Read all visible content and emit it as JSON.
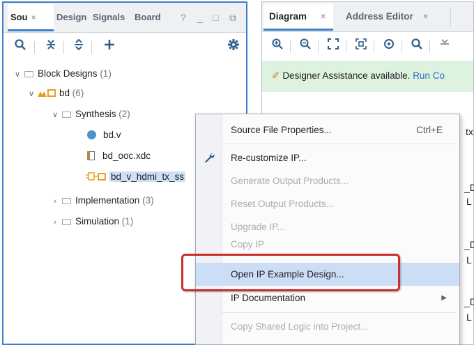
{
  "left_panel": {
    "tabs": [
      {
        "label": "Sou",
        "close": "×",
        "active": true
      },
      {
        "label": "Design",
        "active": false
      },
      {
        "label": "Signals",
        "active": false
      },
      {
        "label": "Board",
        "active": false
      }
    ],
    "window_controls": {
      "help": "?",
      "minimize": "_",
      "maximize": "□",
      "restore": "⧉"
    },
    "toolbar": {
      "search": "search-icon",
      "collapse": "collapse-all-icon",
      "expand": "expand-all-icon",
      "add": "add-icon",
      "settings": "gear-icon"
    },
    "tree": {
      "block_designs": {
        "label": "Block Designs",
        "count": "(1)"
      },
      "bd": {
        "label": "bd",
        "count": "(6)"
      },
      "synthesis": {
        "label": "Synthesis",
        "count": "(2)"
      },
      "bd_v": {
        "label": "bd.v"
      },
      "bd_ooc": {
        "label": "bd_ooc.xdc"
      },
      "bd_v_hdmi": {
        "label": "bd_v_hdmi_tx_ss"
      },
      "implementation": {
        "label": "Implementation",
        "count": "(3)"
      },
      "simulation": {
        "label": "Simulation",
        "count": "(1)"
      }
    }
  },
  "right_panel": {
    "tabs": [
      {
        "label": "Diagram",
        "close": "×",
        "active": true
      },
      {
        "label": "Address Editor",
        "close": "×",
        "active": false
      }
    ],
    "assist": {
      "text": "Designer Assistance available.",
      "link": "Run Co"
    },
    "diagram_fragments": [
      "tx",
      "_D",
      "L",
      "_D",
      "L",
      "_D",
      "L"
    ]
  },
  "context_menu": {
    "items": [
      {
        "label": "Source File Properties...",
        "shortcut": "Ctrl+E",
        "enabled": true
      },
      {
        "label": "Re-customize IP...",
        "enabled": true
      },
      {
        "label": "Generate Output Products...",
        "enabled": false
      },
      {
        "label": "Reset Output Products...",
        "enabled": false
      },
      {
        "label": "Upgrade IP...",
        "enabled": false
      },
      {
        "label": "Copy IP",
        "enabled": false
      },
      {
        "label": "Open IP Example Design...",
        "enabled": true,
        "highlighted": true
      },
      {
        "label": "IP Documentation",
        "enabled": true,
        "submenu": "▶"
      },
      {
        "label": "Copy Shared Logic into Project...",
        "enabled": false
      }
    ]
  },
  "colors": {
    "accent": "#3d7fc8",
    "callout": "#c9302c",
    "highlight": "#cbdef6",
    "assist_bg": "#ddf3e0"
  }
}
